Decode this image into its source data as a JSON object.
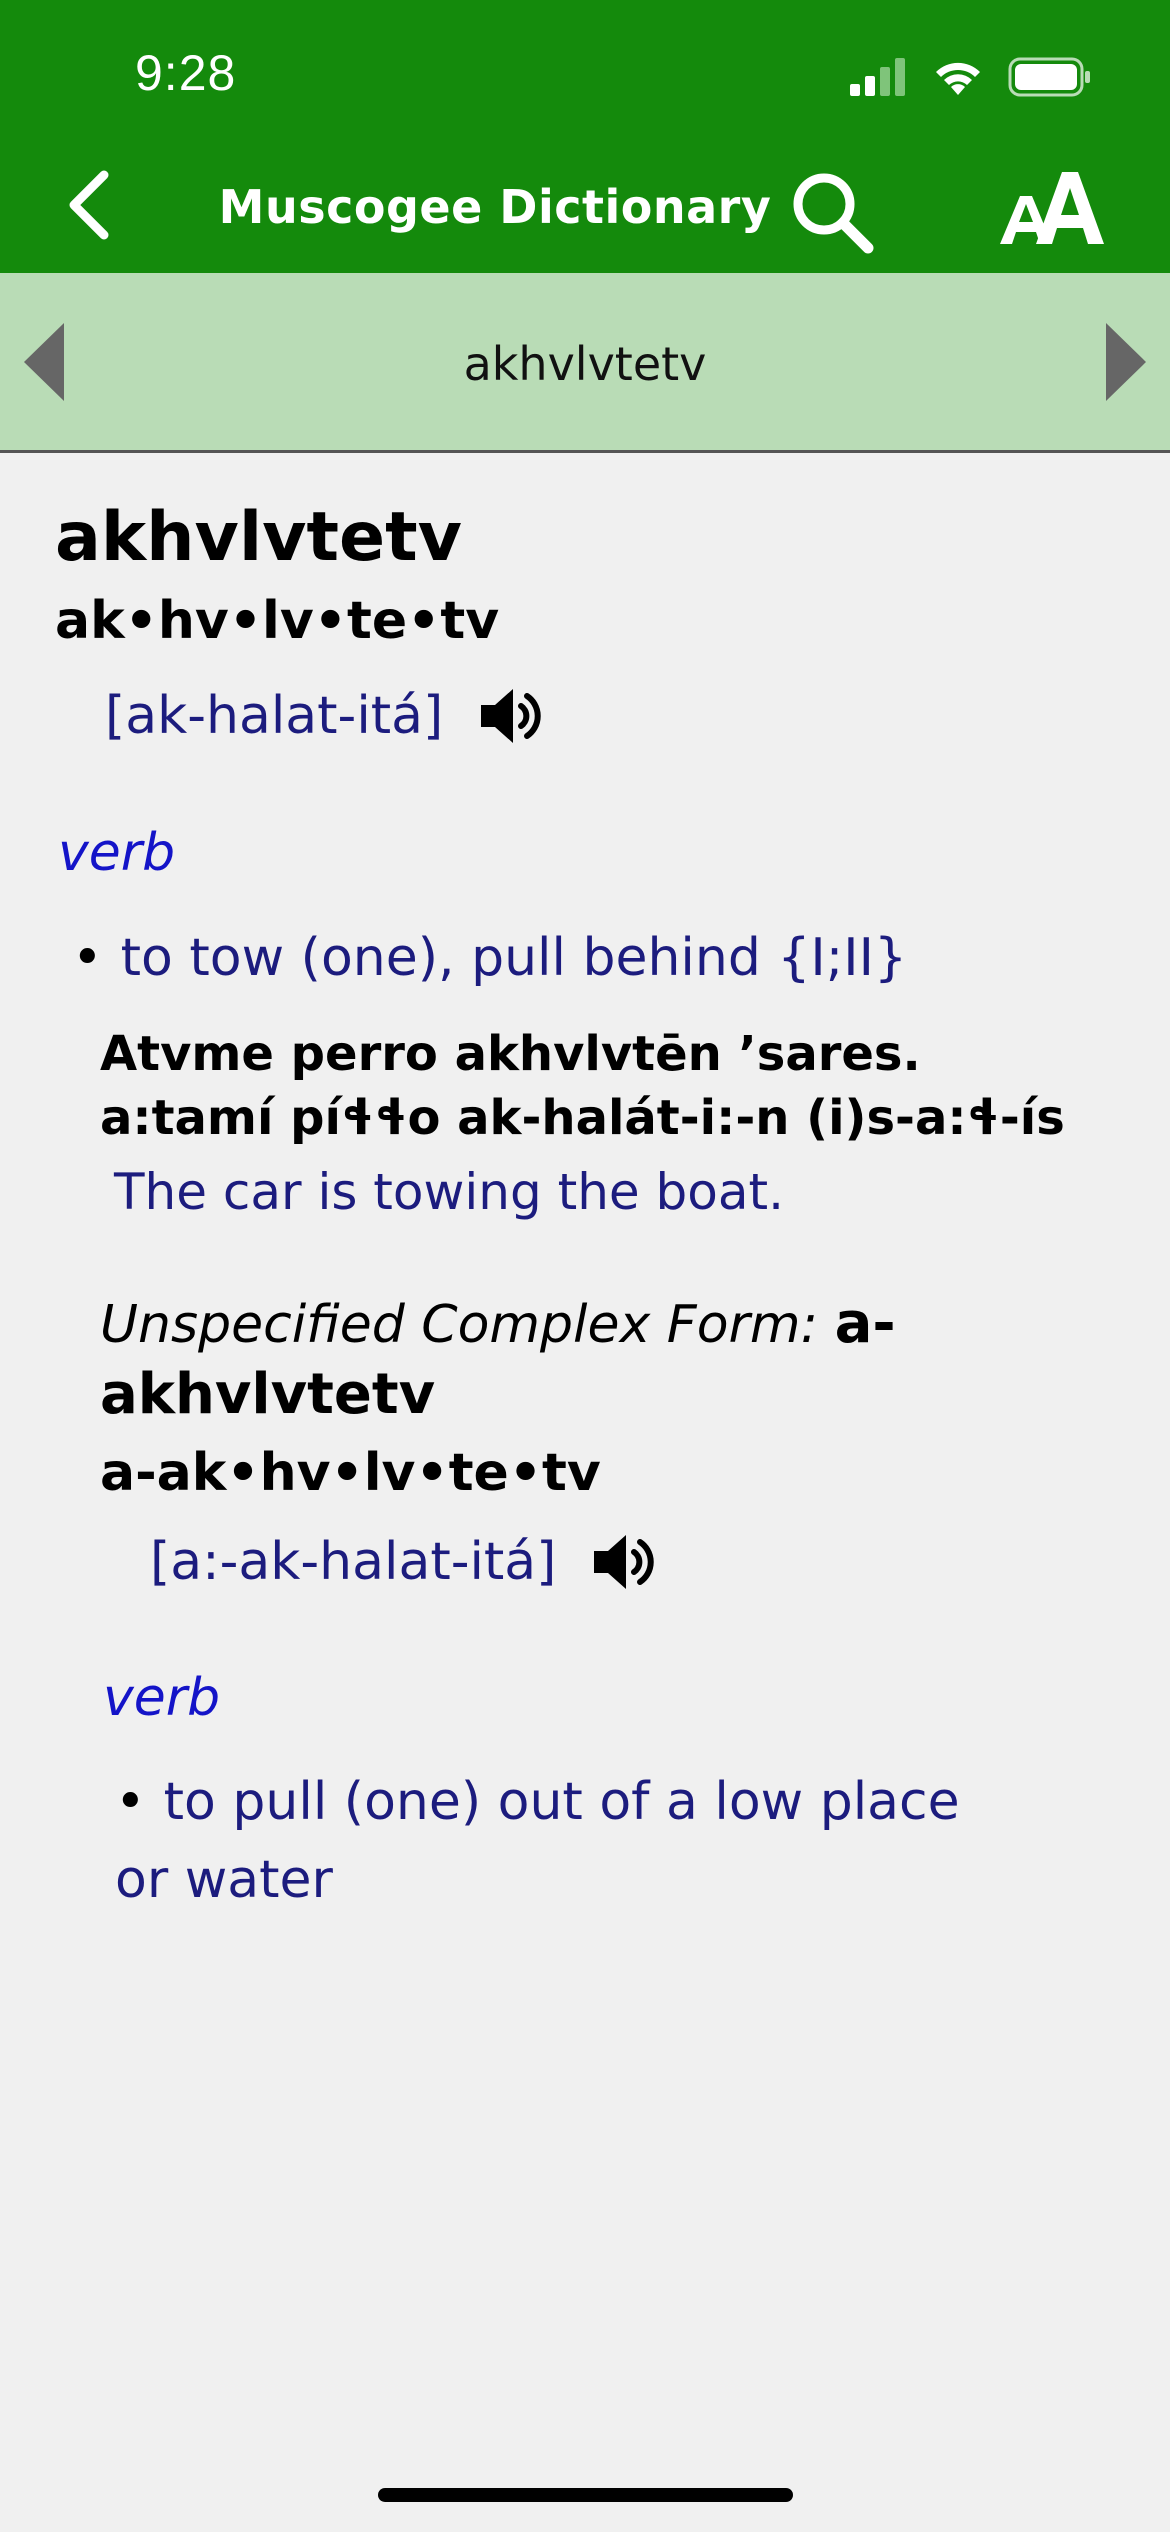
{
  "status": {
    "time": "9:28"
  },
  "nav": {
    "title": "Muscogee Dictionary"
  },
  "strip": {
    "current_word": "akhvlvtetv"
  },
  "entry": {
    "headword": "akhvlvtetv",
    "syllables": "ak•hv•lv•te•tv",
    "pronunciation": "[ak-halat-itá]",
    "part_of_speech": "verb",
    "sense": "to tow (one), pull behind {I;II}",
    "example_muscogee": "Atvme perro akhvlvtēn ’sares.",
    "example_phonetic": "a:tamí píɬɬo ak-halát-i:-n (i)s-a:ɬ-ís",
    "example_translation": "The car is towing the boat.",
    "complex_form": {
      "label": "Unspecified Complex Form:",
      "word": "a-akhvlvtetv",
      "syllables": "a-ak•hv•lv•te•tv",
      "pronunciation": "[a:-ak-halat-itá]",
      "part_of_speech": "verb",
      "sense": "to pull (one) out of a low place or water"
    }
  },
  "colors": {
    "header_green": "#148a0c",
    "strip_green": "#b9dcb6",
    "link_blue": "#1c1c7e",
    "pos_blue": "#1414c8"
  }
}
